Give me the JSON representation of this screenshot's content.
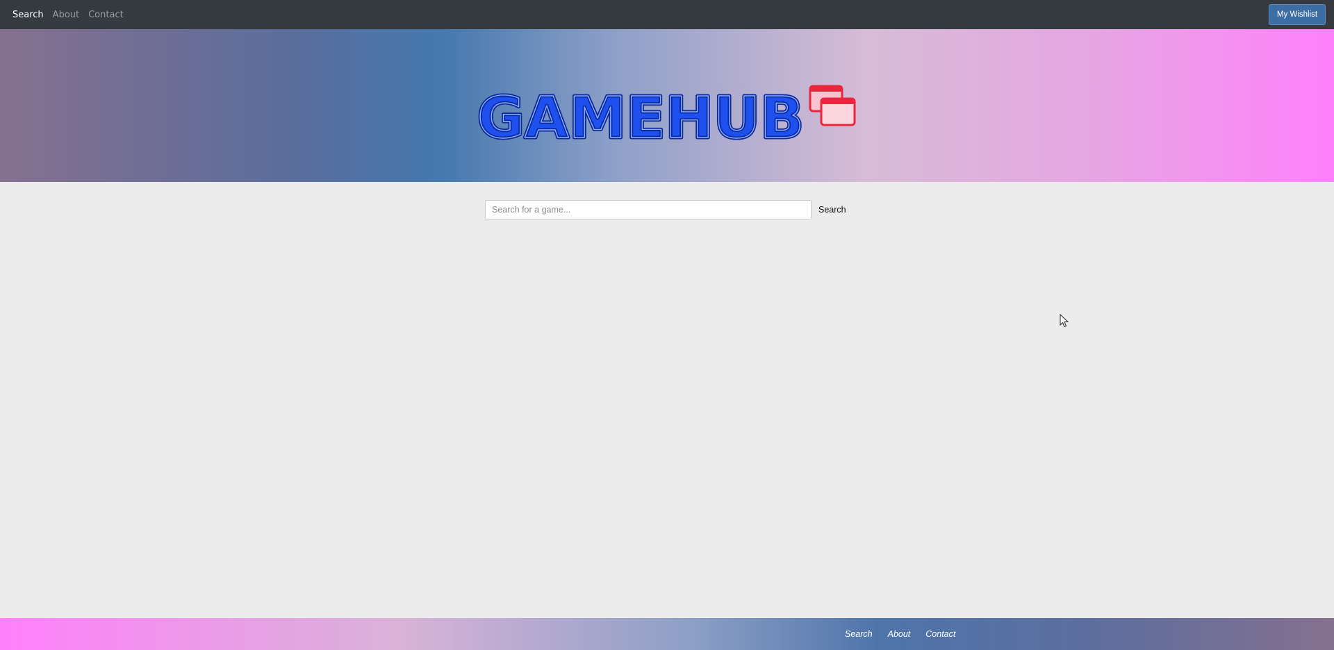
{
  "nav": {
    "items": [
      {
        "label": "Search",
        "active": true
      },
      {
        "label": "About",
        "active": false
      },
      {
        "label": "Contact",
        "active": false
      }
    ],
    "wishlist_label": "My Wishlist"
  },
  "hero": {
    "logo_text": "GAMEHUB",
    "logo_icon": "stacked-windows-icon"
  },
  "search": {
    "placeholder": "Search for a game...",
    "value": "",
    "button_label": "Search"
  },
  "footer": {
    "items": [
      {
        "label": "Search"
      },
      {
        "label": "About"
      },
      {
        "label": "Contact"
      }
    ]
  },
  "colors": {
    "nav_bg": "#343a40",
    "wishlist_bg": "#3c6ea3",
    "logo_blue": "#1e4ff0",
    "logo_red": "#e8273f",
    "page_bg": "#ececec"
  }
}
